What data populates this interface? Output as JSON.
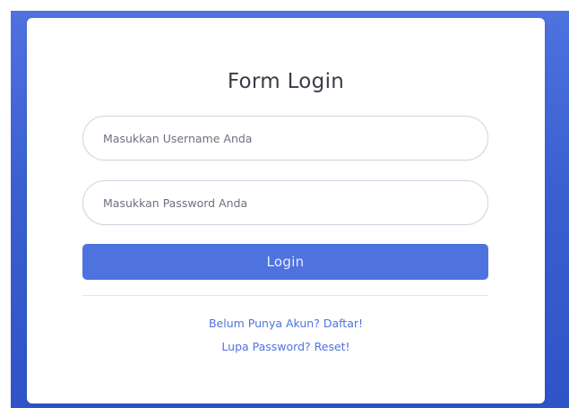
{
  "form": {
    "title": "Form Login",
    "username_placeholder": "Masukkan Username Anda",
    "password_placeholder": "Masukkan Password Anda",
    "login_label": "Login"
  },
  "links": {
    "register": "Belum Punya Akun? Daftar!",
    "reset": "Lupa Password? Reset!"
  },
  "colors": {
    "primary": "#4e73df",
    "background": "#3a5fcf",
    "card": "#ffffff"
  }
}
